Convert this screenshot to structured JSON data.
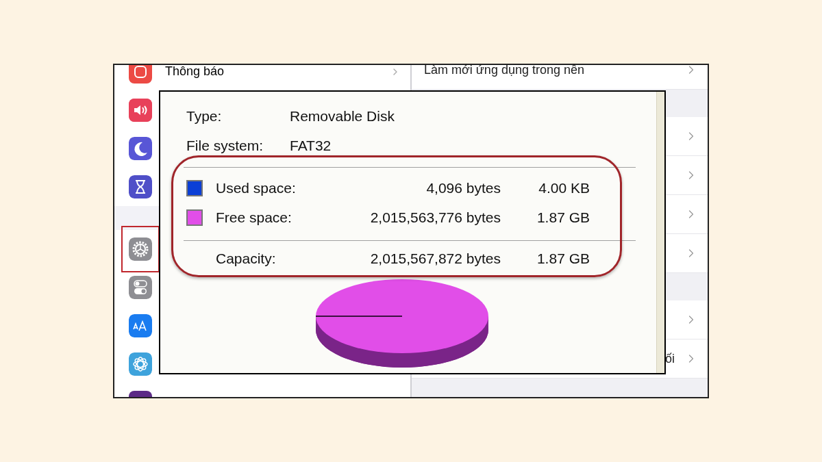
{
  "settings_left": {
    "rows": [
      {
        "kind": "row",
        "label": "Thông báo",
        "highlighted": false
      },
      {
        "kind": "row",
        "highlighted": false
      },
      {
        "kind": "row",
        "highlighted": false
      },
      {
        "kind": "row",
        "highlighted": false
      },
      {
        "kind": "gap"
      },
      {
        "kind": "row",
        "highlighted": true
      },
      {
        "kind": "row",
        "highlighted": false
      },
      {
        "kind": "row",
        "highlighted": false
      },
      {
        "kind": "row",
        "highlighted": false
      },
      {
        "kind": "row",
        "highlighted": false
      }
    ]
  },
  "settings_right": {
    "rows": [
      {
        "kind": "row",
        "label": "Làm mới ứng dụng trong nền"
      },
      {
        "kind": "gap"
      },
      {
        "kind": "row"
      },
      {
        "kind": "row"
      },
      {
        "kind": "row"
      },
      {
        "kind": "row"
      },
      {
        "kind": "gap"
      },
      {
        "kind": "row"
      },
      {
        "kind": "row",
        "label": "ối"
      },
      {
        "kind": "gap"
      }
    ]
  },
  "disk_properties": {
    "info": [
      {
        "label": "Type:",
        "value": "Removable Disk"
      },
      {
        "label": "File system:",
        "value": "FAT32"
      }
    ],
    "space": [
      {
        "label": "Used space:",
        "bytes": "4,096 bytes",
        "size": "4.00 KB",
        "color": "#0b3fd6"
      },
      {
        "label": "Free space:",
        "bytes": "2,015,563,776 bytes",
        "size": "1.87 GB",
        "color": "#e14ee8"
      }
    ],
    "capacity": {
      "label": "Capacity:",
      "bytes": "2,015,567,872 bytes",
      "size": "1.87 GB"
    },
    "highlighted": true
  }
}
